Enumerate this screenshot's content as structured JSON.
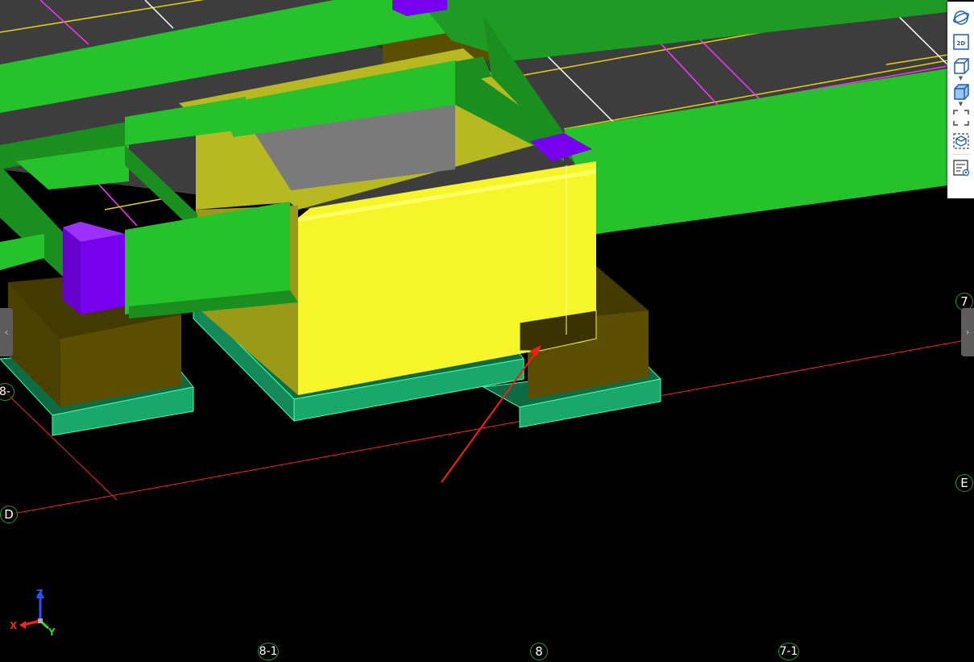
{
  "viewport": {
    "background": "#000000",
    "colors": {
      "beam": "#25c22b",
      "beam_dark": "#1a8f1f",
      "column": "#7700ee",
      "pile_cap": "#5c4e00",
      "foundation": "#19a86a",
      "selected_wall": "#f5f52a",
      "slab": "#3d3d3d",
      "grid_line": "#ff2020"
    }
  },
  "grid_axes": [
    {
      "label": "7"
    },
    {
      "label": "E"
    },
    {
      "label": "D"
    },
    {
      "label": "8-1"
    },
    {
      "label": "8"
    },
    {
      "label": "7-1"
    },
    {
      "label": "8-"
    }
  ],
  "triad": {
    "x": "X",
    "y": "Y",
    "z": "Z"
  },
  "toolbar": {
    "buttons": [
      {
        "name": "orbit-icon",
        "label": ""
      },
      {
        "name": "view-2d-icon",
        "label": "2D"
      },
      {
        "name": "view-3d-box-icon",
        "label": ""
      },
      {
        "name": "display-mode-icon",
        "label": ""
      },
      {
        "name": "fullscreen-icon",
        "label": ""
      },
      {
        "name": "section-box-icon",
        "label": ""
      },
      {
        "name": "properties-icon",
        "label": ""
      }
    ]
  },
  "side_tabs": {
    "left": "‹",
    "right": "›"
  }
}
